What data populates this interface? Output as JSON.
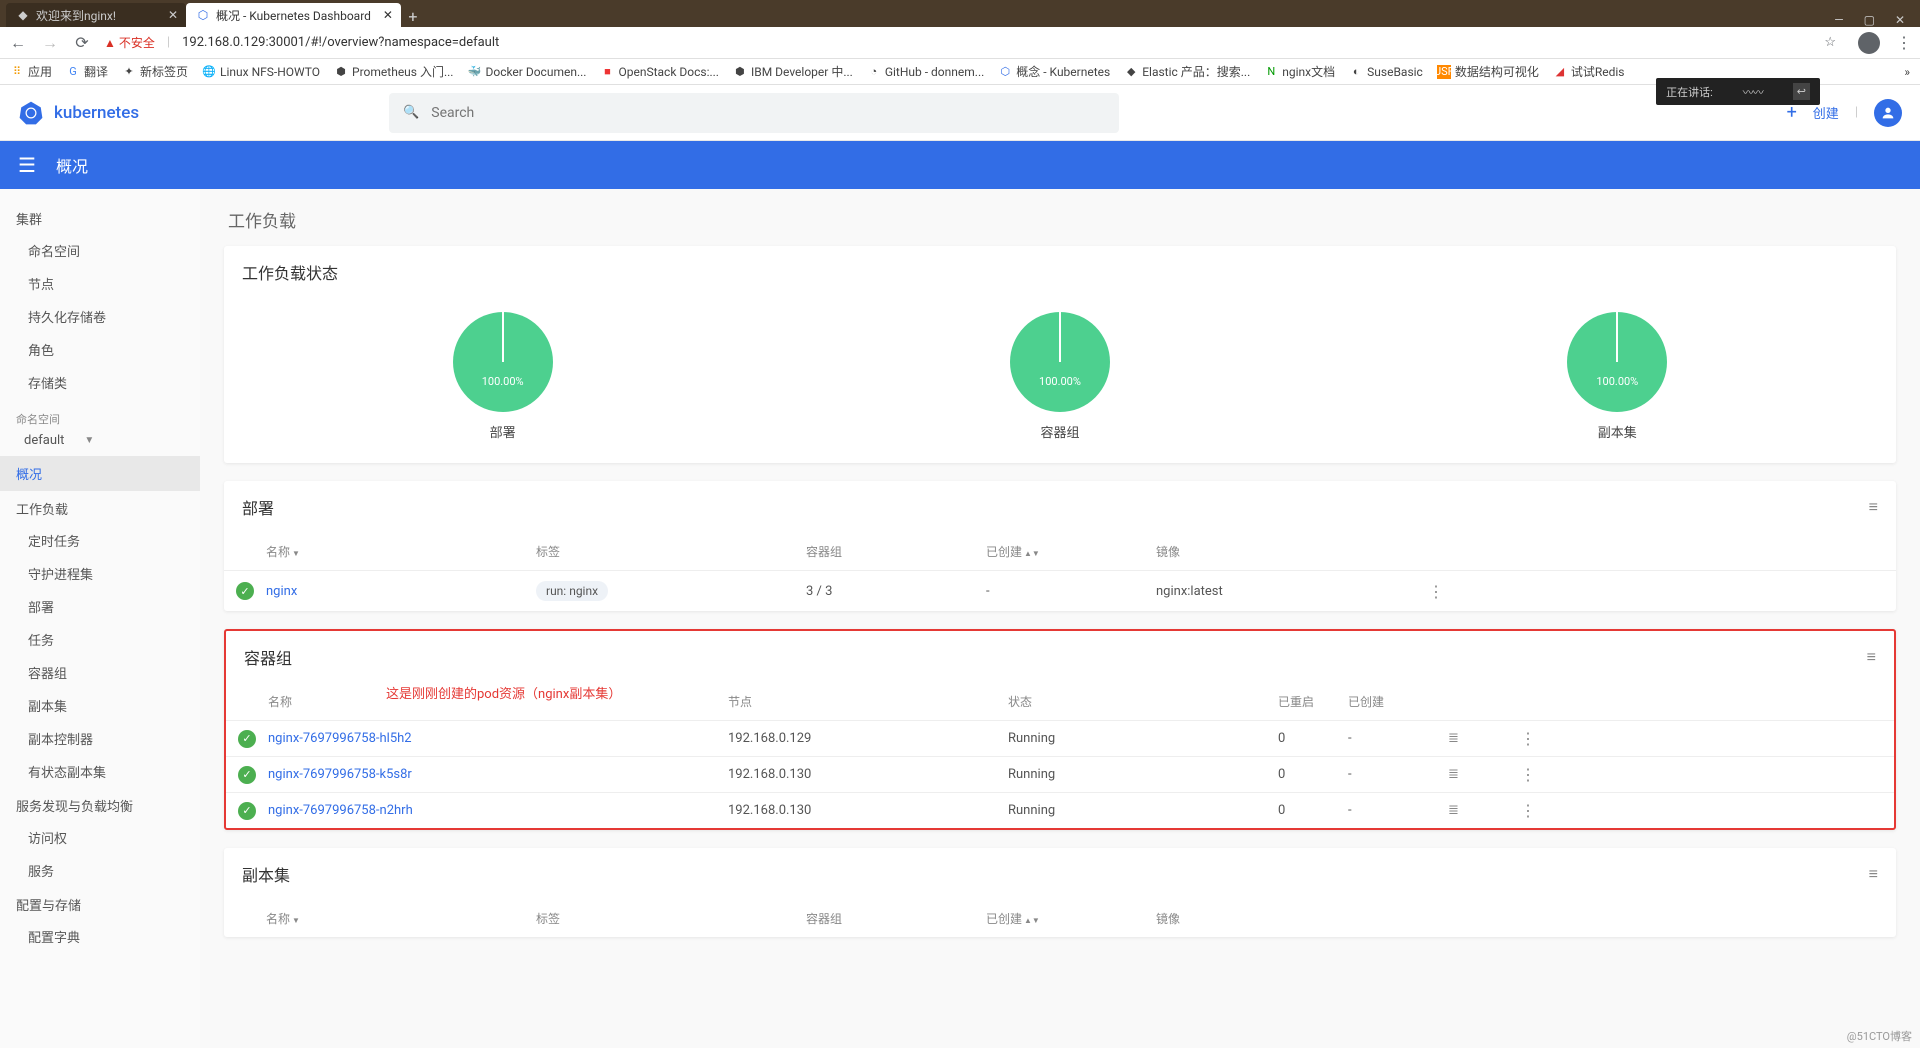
{
  "browser": {
    "tabs": [
      {
        "title": "欢迎来到nginx!",
        "favicon": "nginx"
      },
      {
        "title": "概况 - Kubernetes Dashboard",
        "favicon": "k8s"
      }
    ],
    "url": "192.168.0.129:30001/#!/overview?namespace=default",
    "security": "不安全",
    "bookmarks": [
      {
        "label": "应用",
        "icon": "grid"
      },
      {
        "label": "翻译",
        "icon": "g"
      },
      {
        "label": "新标签页",
        "icon": "star"
      },
      {
        "label": "Linux NFS-HOWTO",
        "icon": "globe"
      },
      {
        "label": "Prometheus 入门...",
        "icon": "prom"
      },
      {
        "label": "Docker Documen...",
        "icon": "docker"
      },
      {
        "label": "OpenStack Docs:...",
        "icon": "os"
      },
      {
        "label": "IBM Developer 中...",
        "icon": "ibm"
      },
      {
        "label": "GitHub - donnem...",
        "icon": "gh"
      },
      {
        "label": "概念 - Kubernetes",
        "icon": "k8s"
      },
      {
        "label": "Elastic 产品：搜索...",
        "icon": "elastic"
      },
      {
        "label": "nginx文档",
        "icon": "nginx"
      },
      {
        "label": "SuseBasic",
        "icon": "suse"
      },
      {
        "label": "数据结构可视化",
        "icon": "usf"
      },
      {
        "label": "试试Redis",
        "icon": "redis"
      }
    ]
  },
  "header": {
    "brand": "kubernetes",
    "search_placeholder": "Search",
    "create": "创建",
    "floating": "正在讲话:"
  },
  "bluebar": {
    "title": "概况"
  },
  "sidebar": {
    "groups": [
      {
        "title": "集群",
        "items": [
          "命名空间",
          "节点",
          "持久化存储卷",
          "角色",
          "存储类"
        ]
      },
      {
        "ns_label": "命名空间",
        "ns_value": "default"
      },
      {
        "active": "概况"
      },
      {
        "title": "工作负载",
        "items": [
          "定时任务",
          "守护进程集",
          "部署",
          "任务",
          "容器组",
          "副本集",
          "副本控制器",
          "有状态副本集"
        ]
      },
      {
        "title": "服务发现与负载均衡",
        "items": [
          "访问权",
          "服务"
        ]
      },
      {
        "title": "配置与存储",
        "items": [
          "配置字典"
        ]
      }
    ]
  },
  "content": {
    "section_title": "工作负载",
    "status_card": {
      "title": "工作负载状态",
      "charts": [
        {
          "label": "部署",
          "pct": "100.00%"
        },
        {
          "label": "容器组",
          "pct": "100.00%"
        },
        {
          "label": "副本集",
          "pct": "100.00%"
        }
      ]
    },
    "deploy": {
      "title": "部署",
      "cols": {
        "name": "名称",
        "labels": "标签",
        "pods": "容器组",
        "created": "已创建",
        "images": "镜像"
      },
      "rows": [
        {
          "name": "nginx",
          "label": "run: nginx",
          "pods": "3 / 3",
          "created": "-",
          "image": "nginx:latest"
        }
      ]
    },
    "pods": {
      "title": "容器组",
      "annotation": "这是刚刚创建的pod资源（nginx副本集）",
      "cols": {
        "name": "名称",
        "node": "节点",
        "status": "状态",
        "restarts": "已重启",
        "created": "已创建"
      },
      "rows": [
        {
          "name": "nginx-7697996758-hl5h2",
          "node": "192.168.0.129",
          "status": "Running",
          "restarts": "0",
          "created": "-"
        },
        {
          "name": "nginx-7697996758-k5s8r",
          "node": "192.168.0.130",
          "status": "Running",
          "restarts": "0",
          "created": "-"
        },
        {
          "name": "nginx-7697996758-n2hrh",
          "node": "192.168.0.130",
          "status": "Running",
          "restarts": "0",
          "created": "-"
        }
      ]
    },
    "rs": {
      "title": "副本集",
      "cols": {
        "name": "名称",
        "labels": "标签",
        "pods": "容器组",
        "created": "已创建",
        "images": "镜像"
      }
    }
  },
  "watermark": "@51CTO博客"
}
